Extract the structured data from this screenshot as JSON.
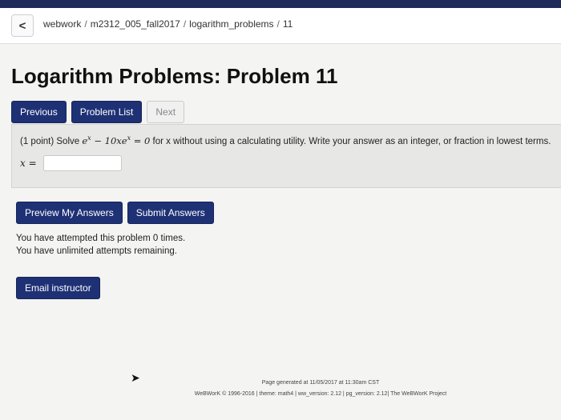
{
  "breadcrumb": {
    "back_icon": "<",
    "parts": [
      "webwork",
      "m2312_005_fall2017",
      "logarithm_problems",
      "11"
    ],
    "separator": "/"
  },
  "page": {
    "title": "Logarithm Problems: Problem 11"
  },
  "nav": {
    "previous": "Previous",
    "problem_list": "Problem List",
    "next": "Next"
  },
  "problem": {
    "points": "(1 point) Solve",
    "instructions": "for x without using a calculating utility. Write your answer as an integer, or fraction in lowest terms.",
    "answer_label": "x =",
    "answer_value": ""
  },
  "actions": {
    "preview": "Preview My Answers",
    "submit": "Submit Answers"
  },
  "status": {
    "attempts": "You have attempted this problem 0 times.",
    "remaining": "You have unlimited attempts remaining."
  },
  "email": {
    "label": "Email instructor"
  },
  "footer": {
    "generated": "Page generated at 11/05/2017 at 11:30am CST",
    "credits": "WeBWorK © 1996-2016 | theme: math4 | ww_version: 2.12 | pg_version: 2.12| The WeBWorK Project"
  },
  "colors": {
    "button": "#1f3175",
    "panel": "#e7e7e5",
    "background": "#f4f4f2"
  }
}
